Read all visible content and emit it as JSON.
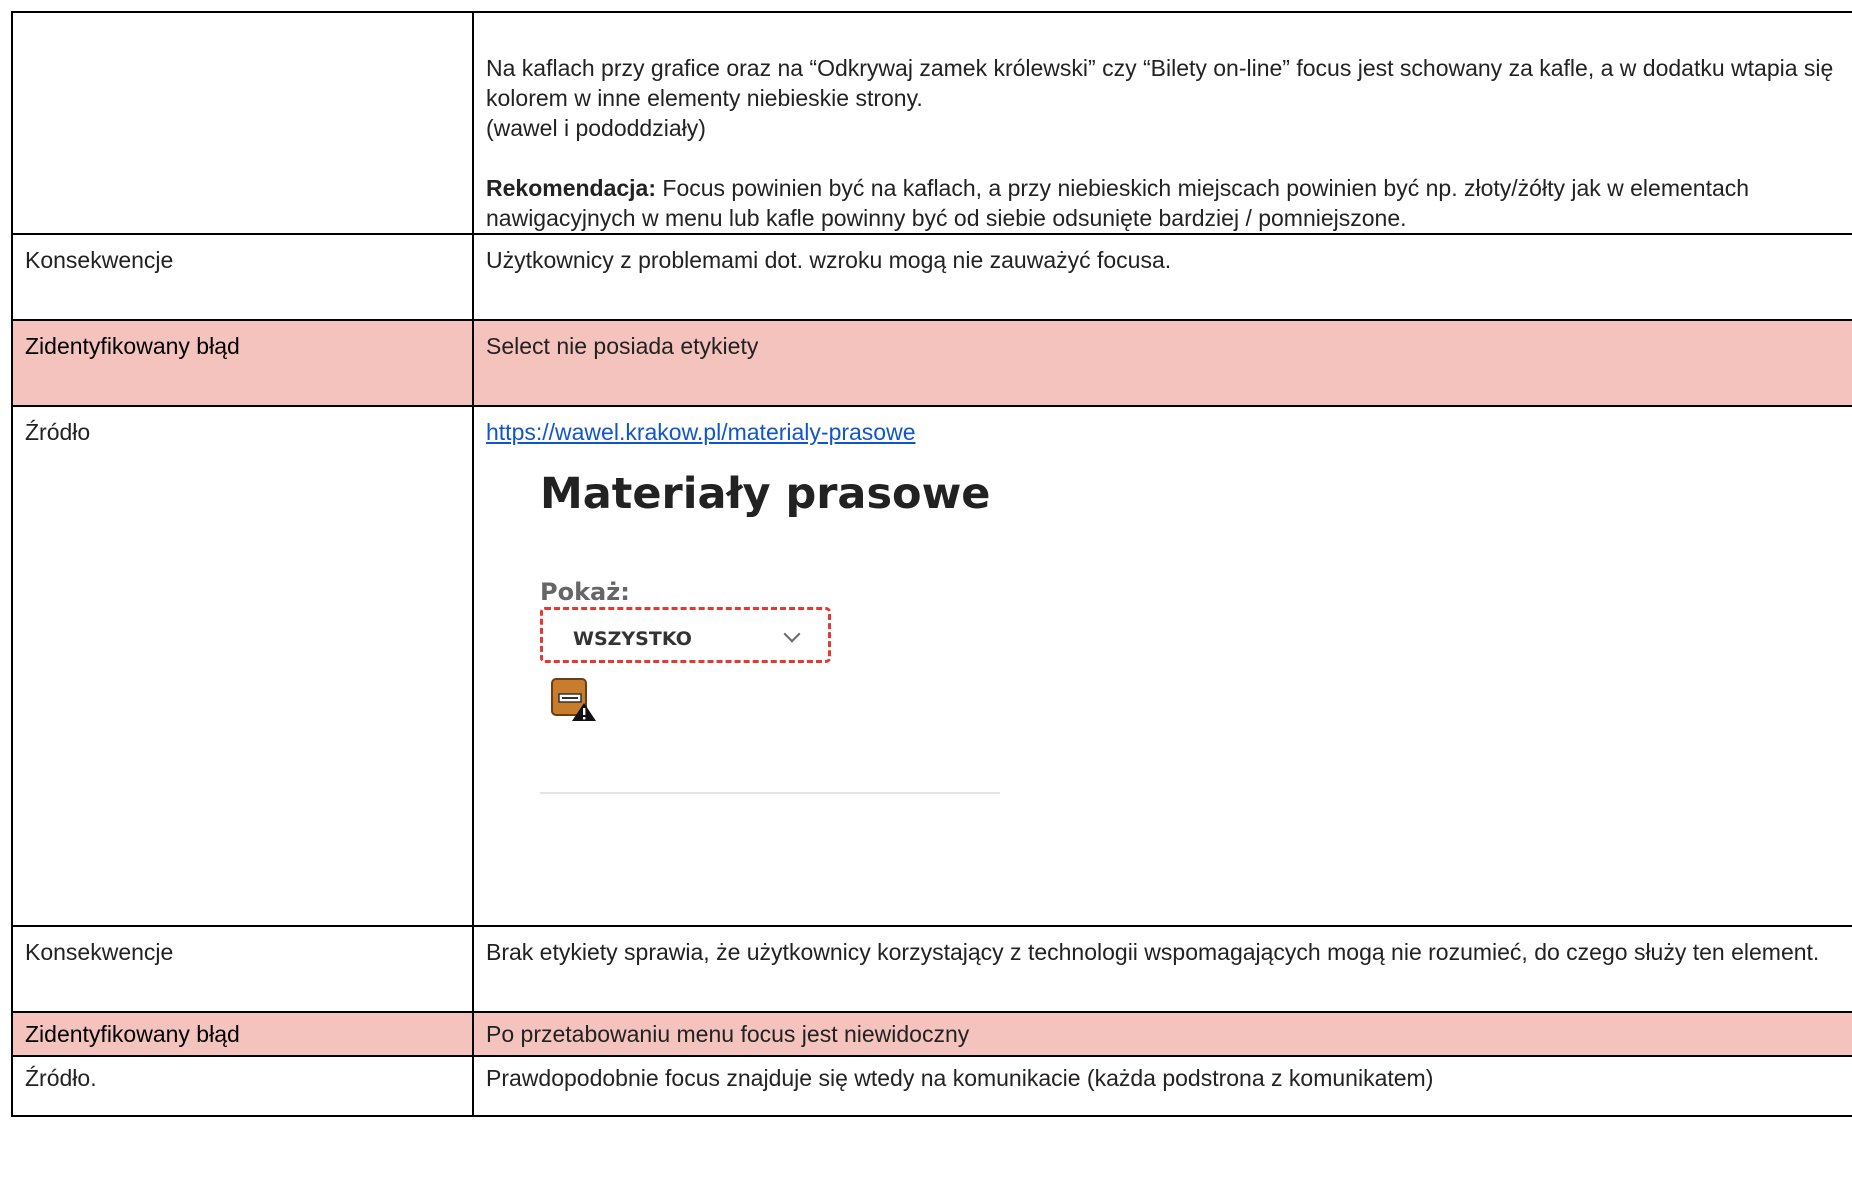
{
  "rows": {
    "r0": {
      "label": "",
      "p1": "Na kaflach przy grafice oraz na “Odkrywaj zamek królewski” czy “Bilety on-line” focus jest schowany za kafle, a w dodatku wtapia się kolorem w inne elementy niebieskie strony.",
      "p2": "(wawel i pododdziały)",
      "rec_label": "Rekomendacja:",
      "rec_text": " Focus powinien być na kaflach, a przy niebieskich miejscach powinien być np. złoty/żółty jak w elementach nawigacyjnych w menu lub kafle powinny być od siebie odsunięte bardziej / pomniejszone."
    },
    "r1": {
      "label": "Konsekwencje",
      "text": "Użytkownicy z problemami dot. wzroku mogą nie zauważyć focusa."
    },
    "r2": {
      "label": "Zidentyfikowany błąd",
      "text": "Select nie posiada etykiety"
    },
    "r3": {
      "label": "Źródło",
      "link": "https://wawel.krakow.pl/materialy-prasowe",
      "shot": {
        "title": "Materiały prasowe",
        "pokaz": "Pokaż:",
        "select_value": "WSZYSTKO"
      }
    },
    "r4": {
      "label": "Konsekwencje",
      "text": "Brak etykiety sprawia, że użytkownicy korzystający z technologii wspomagających mogą nie rozumieć, do czego służy ten element."
    },
    "r5": {
      "label": "Zidentyfikowany błąd",
      "text": "Po przetabowaniu menu focus jest niewidoczny"
    },
    "r6": {
      "label": "Źródło.",
      "text": "Prawdopodobnie focus znajduje się wtedy na komunikacie (każda podstrona z komunikatem)"
    }
  },
  "colors": {
    "error_row_bg": "#f4c3bd",
    "link": "#1155cc",
    "focus_outline": "#e03a34"
  },
  "icons": {
    "select_badge": "select-warning-icon",
    "chevron": "chevron-down-icon"
  }
}
